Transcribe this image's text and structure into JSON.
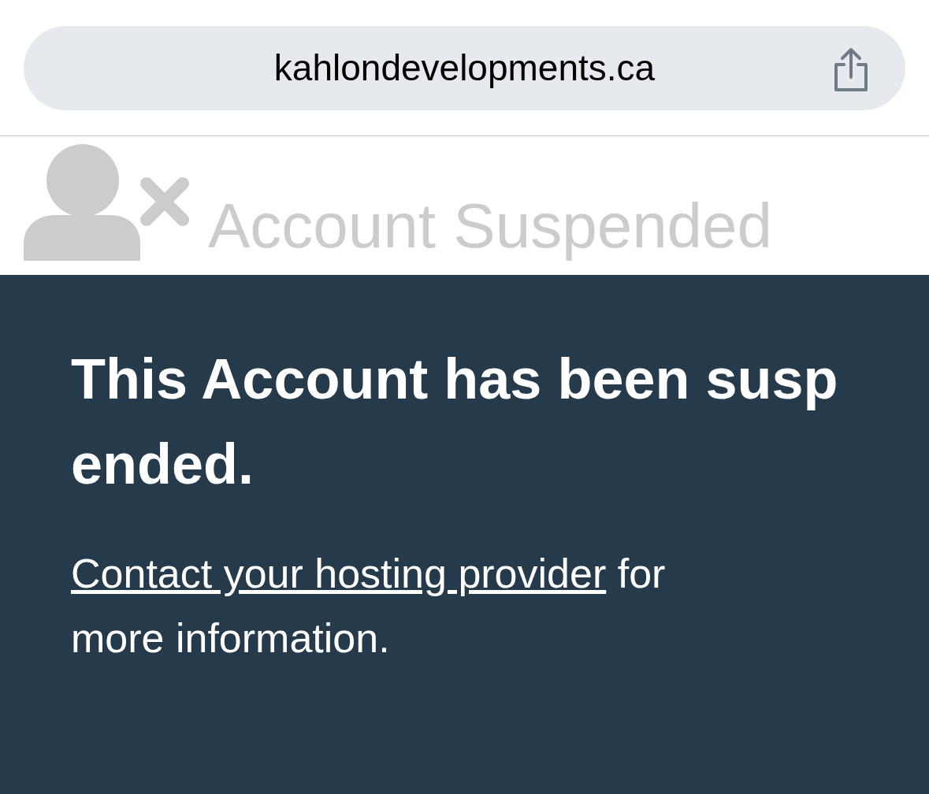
{
  "address_bar": {
    "url": "kahlondevelopments.ca"
  },
  "banner": {
    "title": "Account Suspended"
  },
  "message": {
    "heading": "This Account has been suspended.",
    "link": "Contact your hosting provider",
    "text": "for more information."
  }
}
